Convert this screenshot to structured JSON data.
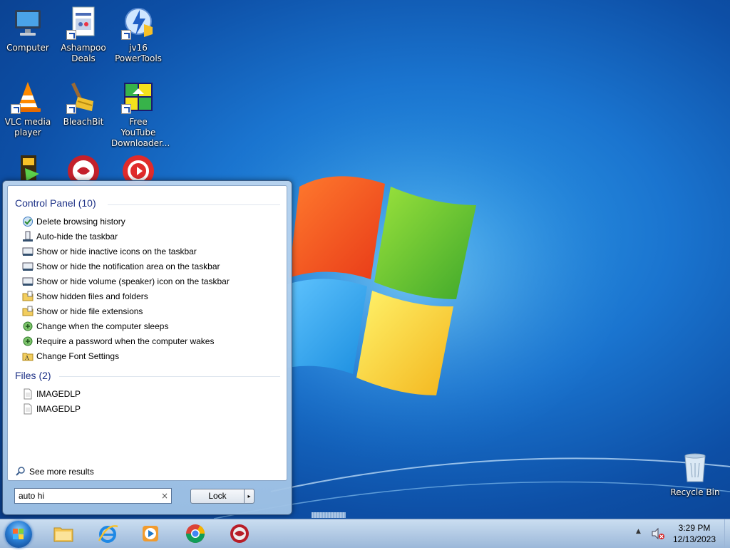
{
  "desktop": {
    "icons": [
      {
        "label": "Computer",
        "icon": "computer-icon"
      },
      {
        "label": "Ashampoo Deals",
        "icon": "ashampoo-deals-icon"
      },
      {
        "label": "jv16 PowerTools",
        "icon": "jv16-powertools-icon"
      },
      {
        "label": "VLC media player",
        "icon": "vlc-icon"
      },
      {
        "label": "BleachBit",
        "icon": "bleachbit-icon"
      },
      {
        "label": "Free YouTube Downloader...",
        "icon": "free-youtube-downloader-icon"
      },
      {
        "label": "Recycle Bin",
        "icon": "recycle-bin-icon"
      }
    ]
  },
  "start_menu": {
    "groups": [
      {
        "title": "Control Panel (10)",
        "items": [
          {
            "label": "Delete browsing history",
            "icon": "internet-options-icon"
          },
          {
            "label": "Auto-hide the taskbar",
            "icon": "taskbar-icon"
          },
          {
            "label": "Show or hide inactive icons on the taskbar",
            "icon": "notification-area-icon"
          },
          {
            "label": "Show or hide the notification area on the taskbar",
            "icon": "notification-area-icon"
          },
          {
            "label": "Show or hide volume (speaker) icon on the taskbar",
            "icon": "notification-area-icon"
          },
          {
            "label": "Show hidden files and folders",
            "icon": "folder-options-icon"
          },
          {
            "label": "Show or hide file extensions",
            "icon": "folder-options-icon"
          },
          {
            "label": "Change when the computer sleeps",
            "icon": "power-options-icon"
          },
          {
            "label": "Require a password when the computer wakes",
            "icon": "power-options-icon"
          },
          {
            "label": "Change Font Settings",
            "icon": "fonts-folder-icon"
          }
        ]
      },
      {
        "title": "Files (2)",
        "items": [
          {
            "label": "IMAGEDLP",
            "icon": "file-icon"
          },
          {
            "label": "IMAGEDLP",
            "icon": "file-icon"
          }
        ]
      }
    ],
    "see_more": "See more results",
    "search": {
      "value": "auto hi",
      "clear": "×"
    },
    "power_button": {
      "label": "Lock",
      "arrow": "▸"
    }
  },
  "taskbar": {
    "apps": [
      "windows-explorer-icon",
      "internet-explorer-icon",
      "media-player-icon",
      "chrome-icon",
      "comodo-icon"
    ],
    "tray": {
      "show_hidden": "▲",
      "time": "3:29 PM",
      "date": "12/13/2023"
    }
  },
  "colors": {
    "group_heading": "#1e3287",
    "desktop_blue": "#1a74cf"
  }
}
